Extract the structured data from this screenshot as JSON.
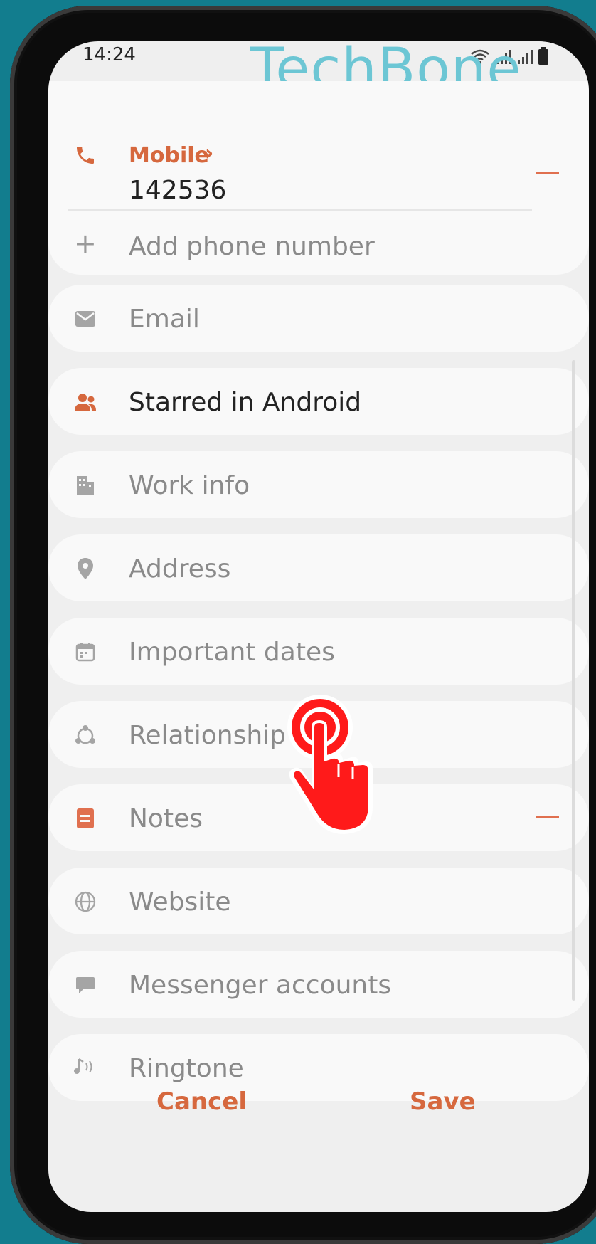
{
  "status": {
    "time": "14:24"
  },
  "watermark": "TechBone",
  "phone": {
    "type_label": "Mobile",
    "number": "142536",
    "add_label": "Add phone number"
  },
  "fields": {
    "email": "Email",
    "group": "Starred in Android",
    "work": "Work info",
    "address": "Address",
    "dates": "Important dates",
    "relationship": "Relationship",
    "notes": "Notes",
    "website": "Website",
    "messenger": "Messenger accounts",
    "ringtone": "Ringtone"
  },
  "actions": {
    "cancel": "Cancel",
    "save": "Save"
  },
  "colors": {
    "accent": "#d6683e",
    "background": "#127d8e",
    "watermark": "#6cc6d4"
  }
}
